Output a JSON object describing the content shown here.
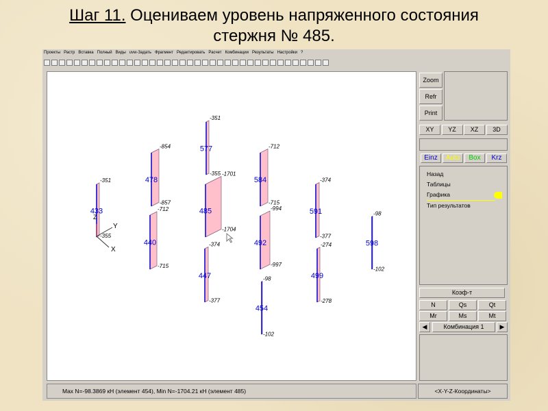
{
  "title": {
    "step": "Шаг 11.",
    "text": " Оцениваем уровень напряженного состояния",
    "line2": "стержня № 485."
  },
  "menu": [
    "Проекты",
    "Растр",
    "Вставка",
    "Полный",
    "Виды",
    "uvw-Задать",
    "Фрагмент",
    "Редактировать",
    "Расчет",
    "Комбинации",
    "Результаты",
    "Настройки",
    "?"
  ],
  "right_panel": {
    "zoom": "Zoom",
    "refr": "Refr",
    "print": "Print",
    "views": [
      "XY",
      "YZ",
      "XZ",
      "3D"
    ],
    "modes": [
      {
        "label": "Einz",
        "color": "#0000cc"
      },
      {
        "label": "Auto",
        "color": "#ffff00"
      },
      {
        "label": "Box",
        "color": "#00cc00"
      },
      {
        "label": "Krz",
        "color": "#0000cc"
      }
    ],
    "list": [
      "Назад",
      "Таблицы",
      "Графика",
      "Тип результатов"
    ],
    "selected": "Графика",
    "koef": "Коэф-т",
    "forces": [
      "N",
      "Qs",
      "Qt",
      "Mr",
      "Ms",
      "Mt"
    ],
    "combination": "Комбинация 1",
    "coords": "<X-Y-Z-Координаты>"
  },
  "status": "Max N=-98.3869 кН (элемент 454), Min N=-1704.21 кН (элемент 485)",
  "axes": {
    "x": "X",
    "y": "Y",
    "z": "Z"
  },
  "members": [
    {
      "id": "433",
      "top": "-351",
      "bottom": "-355"
    },
    {
      "id": "478",
      "top": "-854",
      "bottom": "-857"
    },
    {
      "id": "440",
      "top": "-712",
      "bottom": "-715"
    },
    {
      "id": "577",
      "top": "-351",
      "bottom": "-355"
    },
    {
      "id": "485",
      "top": "-1701",
      "bottom": "-1704"
    },
    {
      "id": "447",
      "top": "-374",
      "bottom": "-377"
    },
    {
      "id": "584",
      "top": "-712",
      "bottom": "-715"
    },
    {
      "id": "492",
      "top": "-994",
      "bottom": "-997"
    },
    {
      "id": "454",
      "top": "-98",
      "bottom": "-102"
    },
    {
      "id": "591",
      "top": "-374",
      "bottom": "-377"
    },
    {
      "id": "499",
      "top": "-274",
      "bottom": "-278"
    },
    {
      "id": "598",
      "top": "-98",
      "bottom": "-102"
    }
  ],
  "colors": {
    "fill": "#ffc0cb",
    "member": "#0000cc",
    "highlight": "#ffff00"
  }
}
